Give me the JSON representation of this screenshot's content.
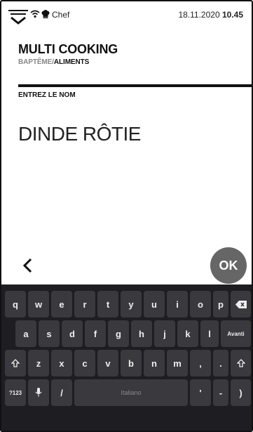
{
  "status": {
    "user": "Chef",
    "date": "18.11.2020",
    "time": "10.45"
  },
  "header": {
    "title": "MULTI COOKING",
    "crumb_parent": "BAPTÊME",
    "crumb_sep": "/",
    "crumb_current": "ALIMENTS"
  },
  "form": {
    "label": "ENTREZ LE NOM",
    "value": "DINDE RÔTIE"
  },
  "actions": {
    "ok_label": "OK"
  },
  "keyboard": {
    "row1": [
      "q",
      "w",
      "e",
      "r",
      "t",
      "y",
      "u",
      "i",
      "o",
      "p"
    ],
    "row2": [
      "a",
      "s",
      "d",
      "f",
      "g",
      "h",
      "j",
      "k",
      "l"
    ],
    "row3": [
      "z",
      "x",
      "c",
      "v",
      "b",
      "n",
      "m",
      ",",
      "."
    ],
    "enter_label": "Avanti",
    "sym_label": "?123",
    "slash_label": "/",
    "space_label": "Italiano",
    "apostrophe_label": "'",
    "dash_label": "-",
    "paren_label": ")"
  },
  "colors": {
    "ok_button": "#666666",
    "keyboard_bg": "#1e1e22",
    "key_bg": "#3a3a3e"
  }
}
